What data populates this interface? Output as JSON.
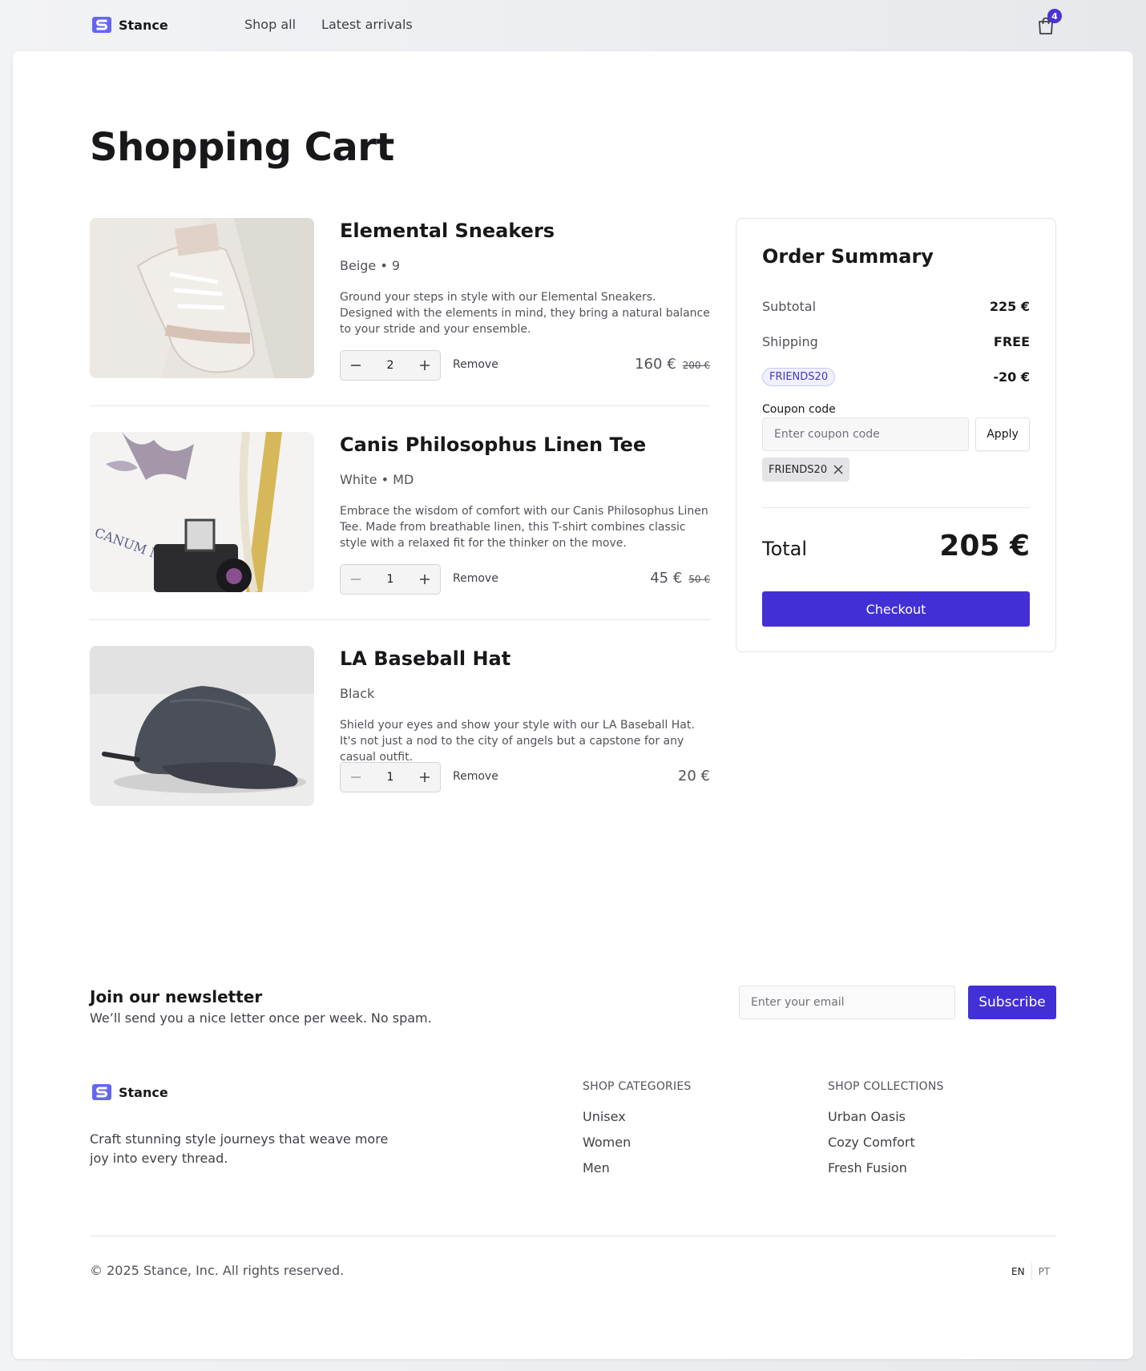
{
  "brand": {
    "name": "Stance"
  },
  "nav": {
    "links": [
      "Shop all",
      "Latest arrivals"
    ],
    "cart_count": "4"
  },
  "page": {
    "title": "Shopping Cart"
  },
  "cart": {
    "items": [
      {
        "title": "Elemental Sneakers",
        "variant": "Beige • 9",
        "description": "Ground your steps in style with our Elemental Sneakers. Designed with the elements in mind, they bring a natural balance to your stride and your ensemble.",
        "quantity": "2",
        "remove_label": "Remove",
        "price": "160 €",
        "original_price": "200 €"
      },
      {
        "title": "Canis Philosophus Linen Tee",
        "variant": "White • MD",
        "description": "Embrace the wisdom of comfort with our Canis Philosophus Linen Tee. Made from breathable linen, this T-shirt combines classic style with a relaxed fit for the thinker on the move.",
        "quantity": "1",
        "remove_label": "Remove",
        "price": "45 €",
        "original_price": "50 €"
      },
      {
        "title": "LA Baseball Hat",
        "variant": "Black",
        "description": "Shield your eyes and show your style with our LA Baseball Hat. It's not just a nod to the city of angels but a capstone for any casual outfit.",
        "quantity": "1",
        "remove_label": "Remove",
        "price": "20 €",
        "original_price": ""
      }
    ]
  },
  "summary": {
    "title": "Order Summary",
    "subtotal_label": "Subtotal",
    "subtotal_value": "225 €",
    "shipping_label": "Shipping",
    "shipping_value": "FREE",
    "discount_code": "FRIENDS20",
    "discount_value": "-20 €",
    "coupon_label": "Coupon code",
    "coupon_placeholder": "Enter coupon code",
    "apply_label": "Apply",
    "applied_coupon": "FRIENDS20",
    "total_label": "Total",
    "total_value": "205 €",
    "checkout_label": "Checkout"
  },
  "newsletter": {
    "title": "Join our newsletter",
    "subtitle": "We’ll send you a nice letter once per week. No spam.",
    "email_placeholder": "Enter your email",
    "subscribe_label": "Subscribe"
  },
  "footer": {
    "tagline": "Craft stunning style journeys that weave more joy into every thread.",
    "categories_heading": "SHOP CATEGORIES",
    "categories": [
      "Unisex",
      "Women",
      "Men"
    ],
    "collections_heading": "SHOP COLLECTIONS",
    "collections": [
      "Urban Oasis",
      "Cozy Comfort",
      "Fresh Fusion"
    ],
    "copyright": "© 2025 Stance, Inc. All rights reserved.",
    "languages": [
      "EN",
      "PT"
    ]
  },
  "colors": {
    "accent": "#4230d6",
    "logo": "#6366f1"
  }
}
